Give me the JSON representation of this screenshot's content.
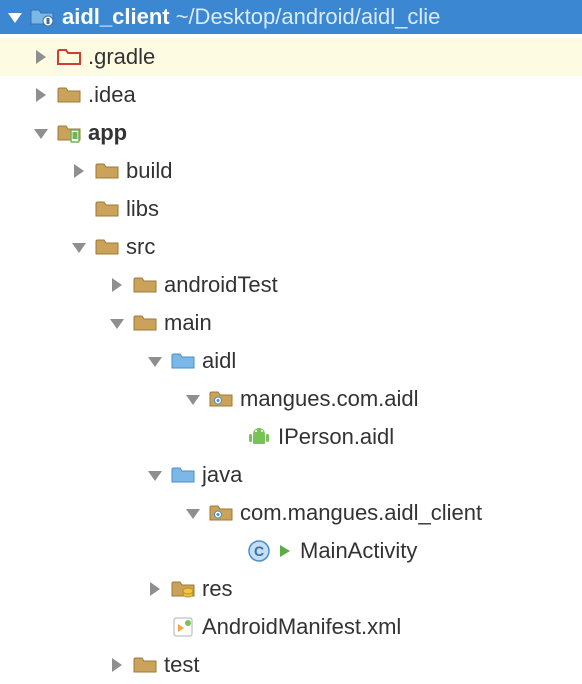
{
  "header": {
    "project_name": "aidl_client",
    "project_path": "~/Desktop/android/aidl_clie"
  },
  "tree": {
    "gradle": ".gradle",
    "idea": ".idea",
    "app": "app",
    "build": "build",
    "libs": "libs",
    "src": "src",
    "androidTest": "androidTest",
    "main": "main",
    "aidl": "aidl",
    "pkg_aidl": "mangues.com.aidl",
    "iperson": "IPerson.aidl",
    "java": "java",
    "pkg_java": "com.mangues.aidl_client",
    "main_activity": "MainActivity",
    "res": "res",
    "manifest": "AndroidManifest.xml",
    "test": "test"
  }
}
